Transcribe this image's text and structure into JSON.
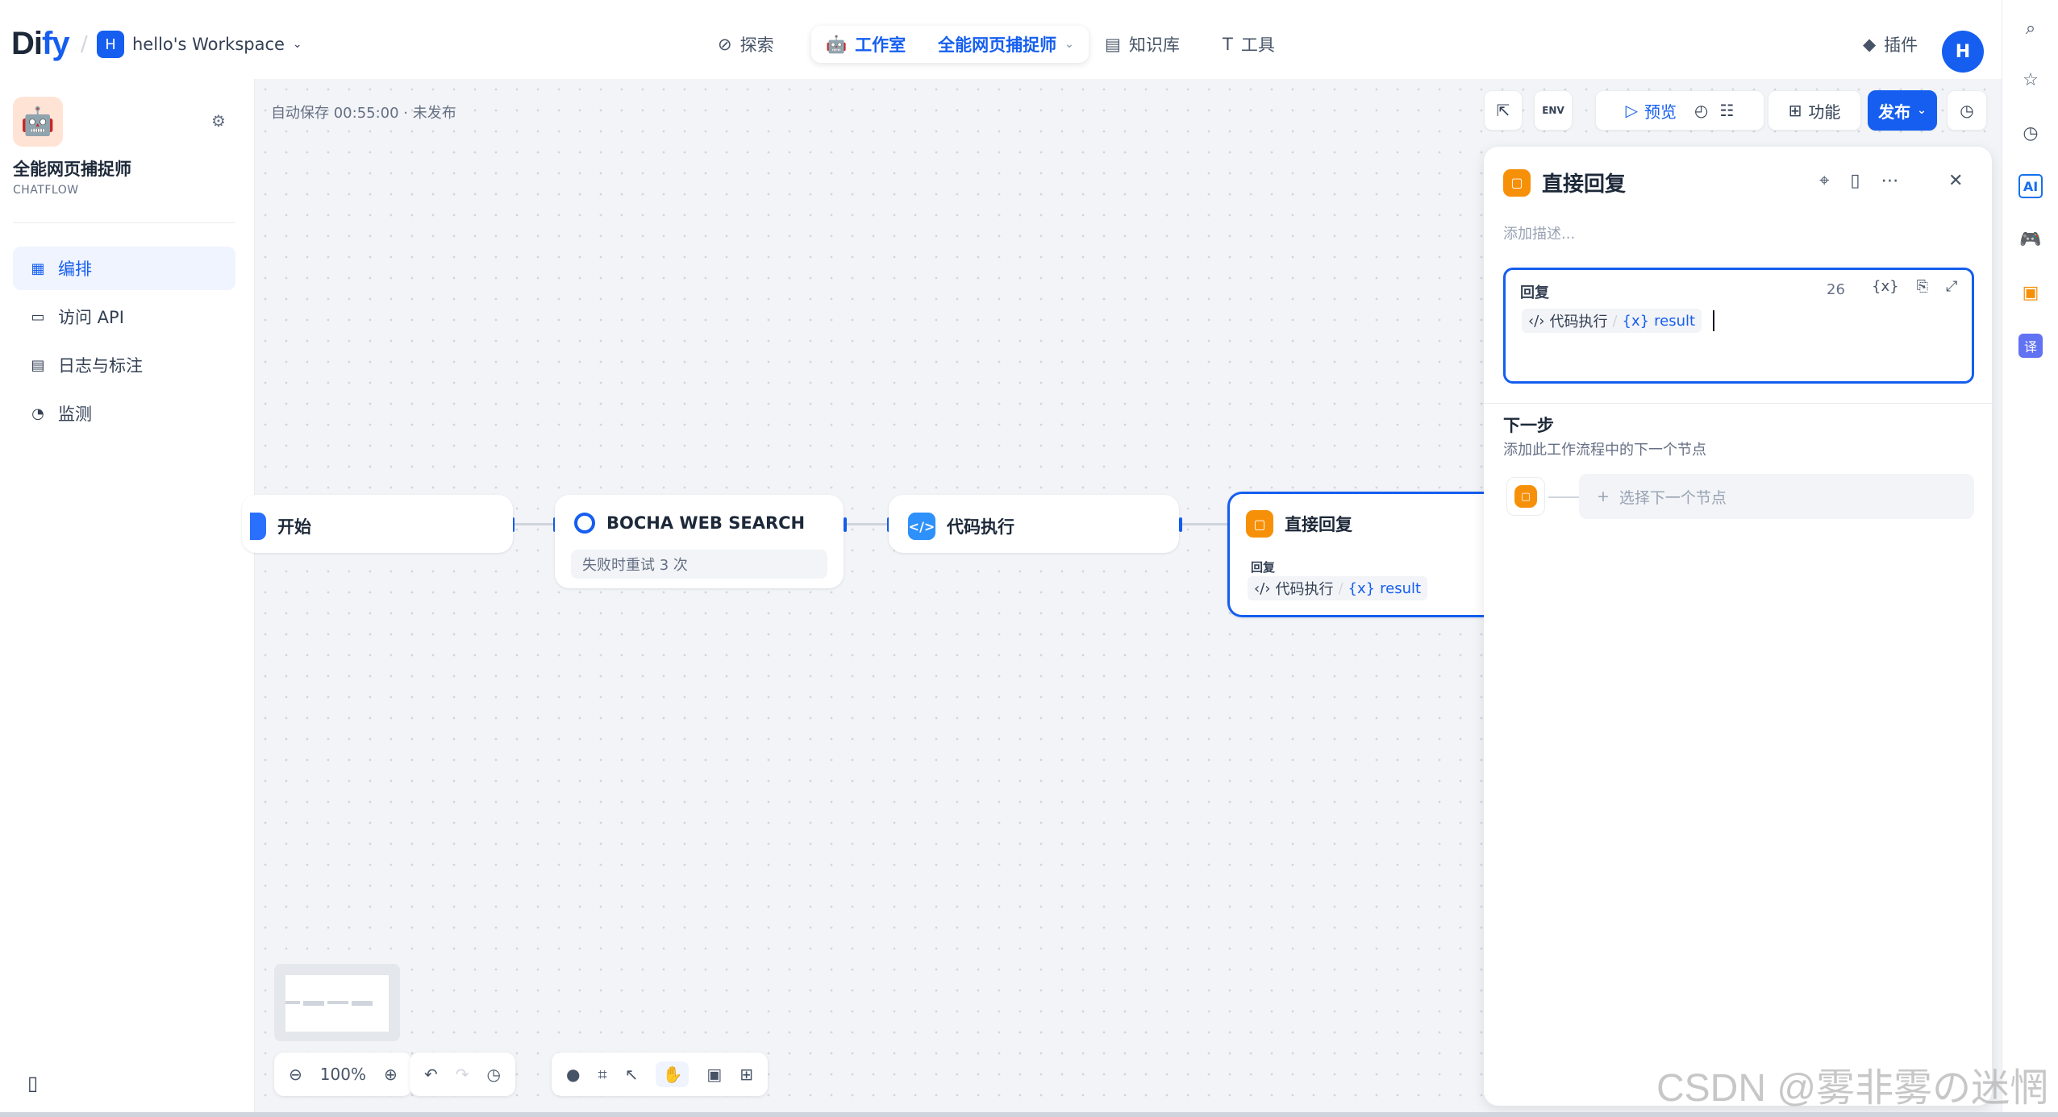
{
  "header": {
    "logo_main": "Di",
    "logo_accent": "fy",
    "workspace_badge": "H",
    "workspace_name": "hello's Workspace",
    "nav": {
      "explore": "探索",
      "studio": "工作室",
      "app_name": "全能网页捕捉师",
      "knowledge": "知识库",
      "tools": "工具",
      "plugins": "插件"
    },
    "avatar": "H"
  },
  "sidebar": {
    "app_name": "全能网页捕捉师",
    "app_type": "CHATFLOW",
    "items": [
      {
        "label": "编排",
        "active": true
      },
      {
        "label": "访问 API"
      },
      {
        "label": "日志与标注"
      },
      {
        "label": "监测"
      }
    ]
  },
  "canvas": {
    "autosave": "自动保存 00:55:00 · 未发布",
    "toolbar": {
      "preview": "预览",
      "features": "功能",
      "publish": "发布"
    },
    "nodes": {
      "start": {
        "title": "开始"
      },
      "bocha": {
        "title": "BOCHA WEB SEARCH",
        "retry": "失败时重试 3 次"
      },
      "code": {
        "title": "代码执行"
      },
      "answer": {
        "title": "直接回复",
        "label": "回复",
        "var_source": "代码执行",
        "var_name": "result"
      }
    },
    "zoom": "100%"
  },
  "panel": {
    "title": "直接回复",
    "description_placeholder": "添加描述...",
    "editor": {
      "label": "回复",
      "count": "26",
      "var_source": "代码执行",
      "var_sep": "/",
      "var_name": "result"
    },
    "next": {
      "title": "下一步",
      "desc": "添加此工作流程中的下一个节点",
      "select_placeholder": "选择下一个节点"
    }
  },
  "watermark": "CSDN @雾非雾の迷惘",
  "colors": {
    "primary": "#155eef",
    "answer_orange": "#f79009",
    "code_blue": "#2e90fa"
  }
}
